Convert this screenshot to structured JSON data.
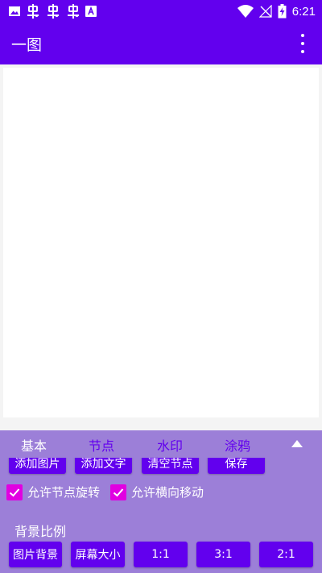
{
  "status_bar": {
    "time": "6:21",
    "left_icons": [
      "image-icon",
      "bug-icon",
      "bug-icon",
      "bug-icon",
      "font-icon"
    ],
    "right_icons": [
      "wifi-icon",
      "no-signal-icon",
      "battery-charging-icon"
    ]
  },
  "app_bar": {
    "title": "一图",
    "menu_icon": "more-vert-icon"
  },
  "bottom_panel": {
    "tabs": [
      {
        "label": "基本",
        "active": true
      },
      {
        "label": "节点",
        "active": false
      },
      {
        "label": "水印",
        "active": false
      },
      {
        "label": "涂鸦",
        "active": false
      }
    ],
    "collapse_icon": "triangle-up-icon",
    "action_buttons": [
      "添加图片",
      "添加文字",
      "清空节点",
      "保存"
    ],
    "checkboxes": [
      {
        "label": "允许节点旋转",
        "checked": true
      },
      {
        "label": "允许横向移动",
        "checked": true
      }
    ],
    "background_ratio": {
      "label": "背景比例",
      "options": [
        "图片背景",
        "屏幕大小",
        "1:1",
        "3:1",
        "2:1"
      ]
    }
  },
  "colors": {
    "primary": "#6200ee",
    "panel": "#9c7fd8",
    "checkbox": "#e100e1"
  }
}
